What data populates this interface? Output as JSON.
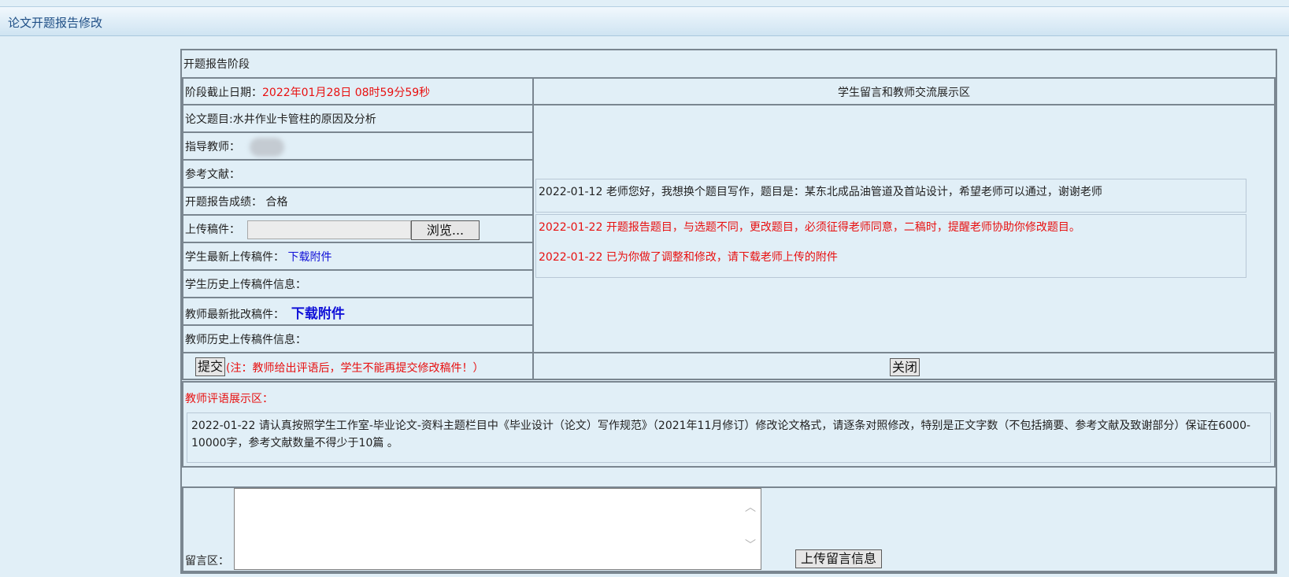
{
  "header": {
    "title": "论文开题报告修改"
  },
  "stage": {
    "title": "开题报告阶段"
  },
  "deadline": {
    "label": "阶段截止日期：",
    "value": "2022年01月28日 08时59分59秒"
  },
  "exchange_area": {
    "title": "学生留言和教师交流展示区"
  },
  "thesis": {
    "label": "论文题目:",
    "value": "水井作业卡管柱的原因及分析"
  },
  "advisor": {
    "label": "指导教师："
  },
  "references": {
    "label": "参考文献："
  },
  "grade": {
    "label": "开题报告成绩：",
    "value": "合格"
  },
  "upload": {
    "label": "上传稿件：",
    "browse_label": "浏览..."
  },
  "student_latest": {
    "label": "学生最新上传稿件：",
    "link": "下载附件"
  },
  "student_history": {
    "label": "学生历史上传稿件信息："
  },
  "teacher_latest": {
    "label": "教师最新批改稿件：",
    "link": "下载附件"
  },
  "teacher_history": {
    "label": "教师历史上传稿件信息："
  },
  "submit": {
    "label": "提交",
    "note": "(注：教师给出评语后，学生不能再提交修改稿件！）"
  },
  "close": {
    "label": "关闭"
  },
  "messages": [
    {
      "date": "2022-01-12",
      "text": "老师您好，我想换个题目写作，题目是：某东北成品油管道及首站设计，希望老师可以通过，谢谢老师"
    },
    {
      "date": "2022-01-22",
      "text": "开题报告题目，与选题不同，更改题目，必须征得老师同意，二稿时，提醒老师协助你修改题目。"
    },
    {
      "date": "2022-01-22",
      "text": "已为你做了调整和修改，请下载老师上传的附件"
    }
  ],
  "comments": {
    "title": "教师评语展示区：",
    "items": [
      {
        "date": "2022-01-22",
        "text": "请认真按照学生工作室-毕业论文-资料主题栏目中《毕业设计（论文）写作规范》（2021年11月修订）修改论文格式，请逐条对照修改，特别是正文字数（不包括摘要、参考文献及致谢部分）保证在6000-10000字，参考文献数量不得少于10篇 。"
      }
    ]
  },
  "message_box": {
    "label": "留言区：",
    "value": "",
    "upload_label": "上传留言信息"
  },
  "colors": {
    "accent_red": "#e81010",
    "link_blue": "#1010d8",
    "background": "#e1eff7"
  }
}
